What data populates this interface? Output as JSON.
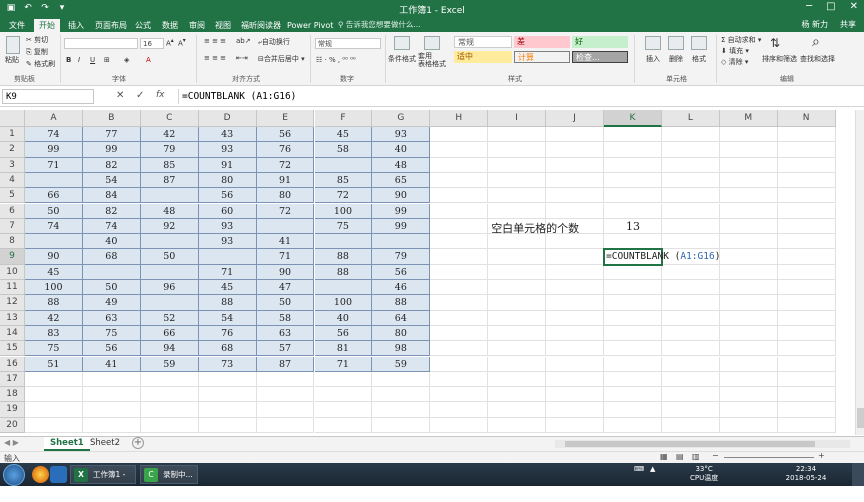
{
  "window": {
    "title": "工作簿1 - Excel",
    "controls": [
      "─",
      "□",
      "✕"
    ]
  },
  "tabs": {
    "items": [
      "文件",
      "开始",
      "插入",
      "页面布局",
      "公式",
      "数据",
      "审阅",
      "视图",
      "福昕阅读器",
      "Power Pivot"
    ],
    "active": "开始",
    "tell_me": "告诉我您想要做什么...",
    "user": "杨 新力",
    "share": "共享"
  },
  "ribbon": {
    "paste": "粘贴",
    "cut": "剪切",
    "copy": "复制",
    "format_painter": "格式刷",
    "clipboard_group": "剪贴板",
    "font_size": "16",
    "font_group": "字体",
    "wrap_text": "自动换行",
    "merge_center": "合并后居中",
    "alignment_group": "对齐方式",
    "number_format": "常规",
    "number_group": "数字",
    "conditional_format": "条件格式",
    "format_as_table": "套用\n表格格式",
    "styles": [
      "常规",
      "差",
      "好",
      "适中",
      "计算",
      "检查..."
    ],
    "styles_group": "样式",
    "insert": "插入",
    "delete": "删除",
    "format": "格式",
    "cells_group": "单元格",
    "autosum": "自动求和",
    "fill": "填充",
    "clear": "清除",
    "sort_filter": "排序和筛选",
    "find_select": "查找和选择",
    "editing_group": "编辑",
    "bold": "B",
    "italic": "I",
    "underline": "U"
  },
  "formula_bar": {
    "name_box": "K9",
    "cancel": "✕",
    "enter": "✓",
    "fx": "fx",
    "formula": "=COUNTBLANK (A1:G16)"
  },
  "grid": {
    "columns": [
      "A",
      "B",
      "C",
      "D",
      "E",
      "F",
      "G",
      "H",
      "I",
      "J",
      "K",
      "L",
      "M",
      "N"
    ],
    "selected_column": "K",
    "rows": [
      "1",
      "2",
      "3",
      "4",
      "5",
      "6",
      "7",
      "8",
      "9",
      "10",
      "11",
      "12",
      "13",
      "14",
      "15",
      "16",
      "17",
      "18",
      "19",
      "20"
    ],
    "selected_row": "9",
    "data": [
      [
        "74",
        "77",
        "42",
        "43",
        "56",
        "45",
        "93"
      ],
      [
        "99",
        "99",
        "79",
        "93",
        "76",
        "58",
        "40"
      ],
      [
        "71",
        "82",
        "85",
        "91",
        "72",
        "",
        "48"
      ],
      [
        "",
        "54",
        "87",
        "80",
        "91",
        "85",
        "65"
      ],
      [
        "66",
        "84",
        "",
        "56",
        "80",
        "72",
        "90"
      ],
      [
        "50",
        "82",
        "48",
        "60",
        "72",
        "100",
        "99"
      ],
      [
        "74",
        "74",
        "92",
        "93",
        "",
        "75",
        "99"
      ],
      [
        "",
        "40",
        "",
        "93",
        "41",
        "",
        ""
      ],
      [
        "90",
        "68",
        "50",
        "",
        "71",
        "88",
        "79"
      ],
      [
        "45",
        "",
        "",
        "71",
        "90",
        "88",
        "56"
      ],
      [
        "100",
        "50",
        "96",
        "45",
        "47",
        "",
        "46"
      ],
      [
        "88",
        "49",
        "",
        "88",
        "50",
        "100",
        "88"
      ],
      [
        "42",
        "63",
        "52",
        "54",
        "58",
        "40",
        "64"
      ],
      [
        "83",
        "75",
        "66",
        "76",
        "63",
        "56",
        "80"
      ],
      [
        "75",
        "56",
        "94",
        "68",
        "57",
        "81",
        "98"
      ],
      [
        "51",
        "41",
        "59",
        "73",
        "87",
        "71",
        "59"
      ]
    ],
    "label_text": "空白单元格的个数",
    "label_value": "13",
    "edit_formula_prefix": "=COUNTBLANK (",
    "edit_formula_ref": "A1:G16",
    "edit_formula_suffix": ")"
  },
  "sheets": {
    "tabs": [
      "Sheet1",
      "Sheet2"
    ],
    "active": "Sheet1",
    "add": "+"
  },
  "status": {
    "mode": "输入"
  },
  "taskbar": {
    "app1": "工作簿1 - Ex...",
    "app2": "录制中...",
    "temp": "33°C",
    "temp_label": "CPU温度",
    "time": "22:34",
    "date": "2018-05-24"
  },
  "colors": {
    "excel_green": "#217346",
    "data_fill": "#dce6f1",
    "data_border": "#7d93b4",
    "ref_blue": "#2e66b5"
  }
}
